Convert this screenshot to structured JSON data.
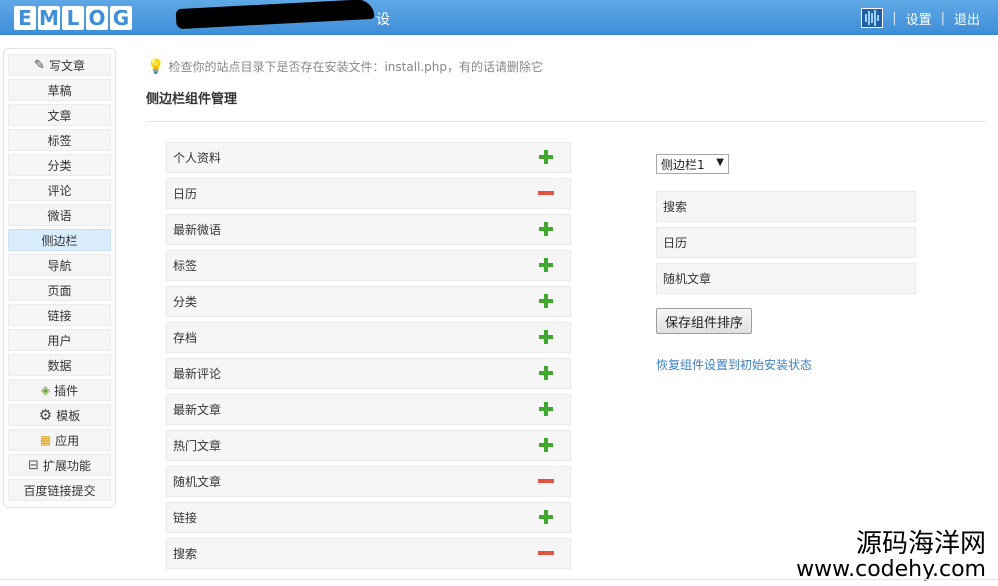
{
  "header": {
    "logo": "EMLOG",
    "site_title": "设",
    "settings_label": "设置",
    "logout_label": "退出",
    "separator": "|"
  },
  "sidebar": {
    "items": [
      {
        "label": "写文章",
        "icon": "pen-icon"
      },
      {
        "label": "草稿"
      },
      {
        "label": "文章"
      },
      {
        "label": "标签"
      },
      {
        "label": "分类"
      },
      {
        "label": "评论"
      },
      {
        "label": "微语"
      },
      {
        "label": "侧边栏",
        "active": true
      },
      {
        "label": "导航"
      },
      {
        "label": "页面"
      },
      {
        "label": "链接"
      },
      {
        "label": "用户"
      },
      {
        "label": "数据"
      },
      {
        "label": "插件",
        "icon": "plugin-icon"
      },
      {
        "label": "模板",
        "icon": "gear-icon"
      },
      {
        "label": "应用",
        "icon": "app-icon"
      },
      {
        "label": "扩展功能",
        "icon": "collapse-icon",
        "prefix": "⊟"
      },
      {
        "label": "百度链接提交"
      }
    ]
  },
  "tip": {
    "text": "检查你的站点目录下是否存在安装文件：install.php，有的话请删除它"
  },
  "page": {
    "title": "侧边栏组件管理"
  },
  "widgets": [
    {
      "label": "个人资料",
      "state": "add"
    },
    {
      "label": "日历",
      "state": "remove"
    },
    {
      "label": "最新微语",
      "state": "add"
    },
    {
      "label": "标签",
      "state": "add"
    },
    {
      "label": "分类",
      "state": "add"
    },
    {
      "label": "存档",
      "state": "add"
    },
    {
      "label": "最新评论",
      "state": "add"
    },
    {
      "label": "最新文章",
      "state": "add"
    },
    {
      "label": "热门文章",
      "state": "add"
    },
    {
      "label": "随机文章",
      "state": "remove"
    },
    {
      "label": "链接",
      "state": "add"
    },
    {
      "label": "搜索",
      "state": "remove"
    }
  ],
  "right_panel": {
    "select_value": "侧边栏1",
    "active_widgets": [
      "搜索",
      "日历",
      "随机文章"
    ],
    "save_label": "保存组件排序",
    "reset_label": "恢复组件设置到初始安装状态"
  },
  "watermark": {
    "line1": "源码海洋网",
    "line2": "www.codehy.com"
  },
  "colors": {
    "header": "#4a9ae0",
    "add": "#3fa92e",
    "remove": "#e2543d",
    "link": "#3a7fc2",
    "active_nav": "#d9ecfb"
  }
}
